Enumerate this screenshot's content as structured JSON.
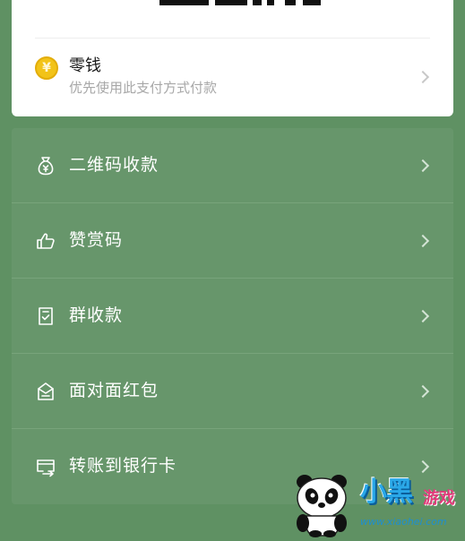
{
  "payment": {
    "method_title": "零钱",
    "method_subtitle": "优先使用此支付方式付款",
    "coin_symbol": "¥",
    "coin_color": "#f2c318"
  },
  "menu": {
    "items": [
      {
        "label": "二维码收款",
        "icon": "money-bag-icon"
      },
      {
        "label": "赞赏码",
        "icon": "thumbs-up-icon"
      },
      {
        "label": "群收款",
        "icon": "group-bill-icon"
      },
      {
        "label": "面对面红包",
        "icon": "red-packet-icon"
      },
      {
        "label": "转账到银行卡",
        "icon": "bank-card-transfer-icon"
      }
    ]
  },
  "theme": {
    "background": "#5f9163",
    "card_green": "#67966b",
    "text_white": "#ffffff",
    "subtitle_gray": "#a8a8a8"
  },
  "watermark": {
    "text_cn": "小黑",
    "text_game": "游戏",
    "url": "www.xiaohei.com"
  }
}
